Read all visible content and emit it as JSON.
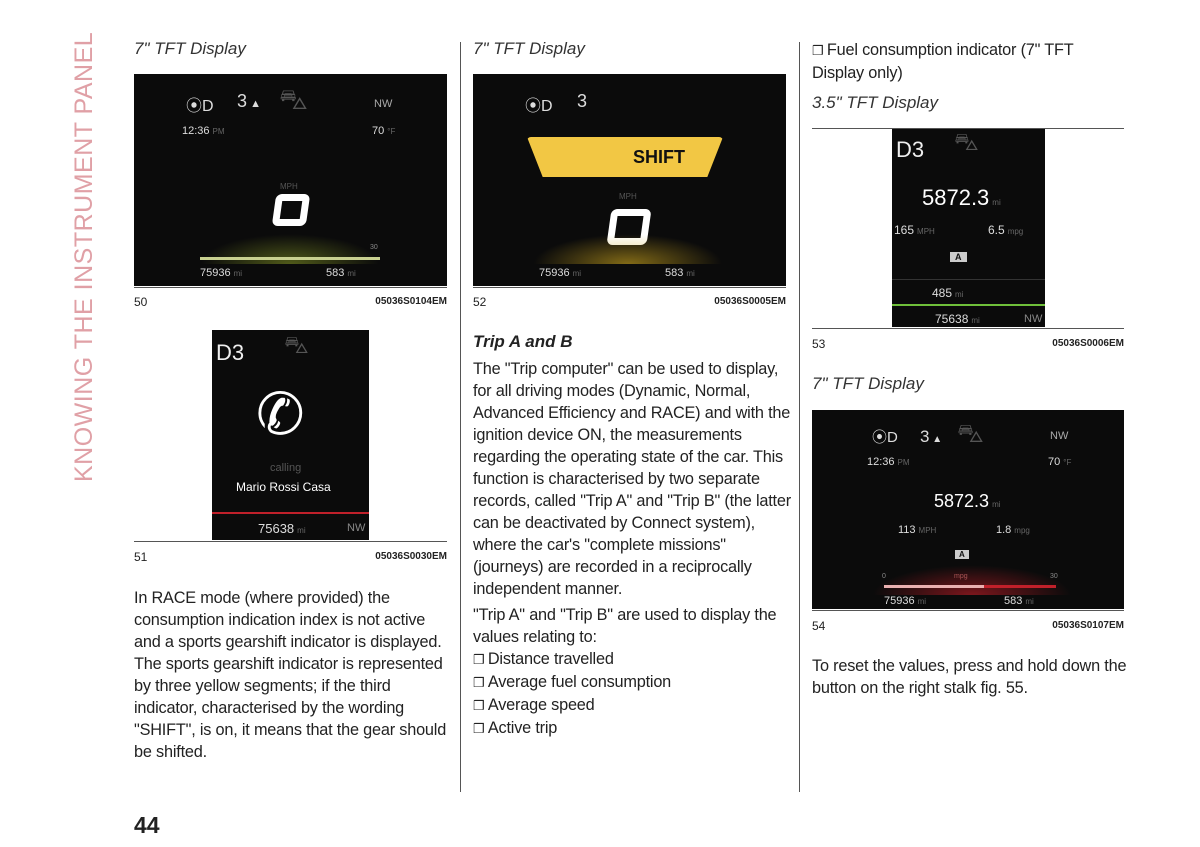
{
  "side_title": "KNOWING THE INSTRUMENT PANEL",
  "page_number": "44",
  "col1": {
    "caption": "7\" TFT Display",
    "fig50": {
      "number": "50",
      "code": "05036S0104EM",
      "gear": "3",
      "time": "12:36",
      "time_unit": "PM",
      "heading": "NW",
      "temp": "70",
      "temp_unit": "°F",
      "speed_unit": "MPH",
      "speed": "0",
      "odo": "75936",
      "odo_unit": "mi",
      "range": "583",
      "range_unit": "mi",
      "scale_max": "30"
    },
    "fig51": {
      "number": "51",
      "code": "05036S0030EM",
      "gear": "D3",
      "status": "calling",
      "contact": "Mario Rossi Casa",
      "odo": "75638",
      "odo_unit": "mi",
      "heading": "NW"
    },
    "paragraph": "In RACE mode (where provided) the consumption indication index is not active and a sports gearshift indicator is displayed. The sports gearshift indicator is represented by three yellow segments; if the third indicator, characterised by the wording \"SHIFT\", is on, it means that the gear should be shifted."
  },
  "col2": {
    "caption": "7\" TFT Display",
    "fig52": {
      "number": "52",
      "code": "05036S0005EM",
      "gear": "3",
      "shift": "SHIFT",
      "speed_unit": "MPH",
      "speed": "0",
      "odo": "75936",
      "odo_unit": "mi",
      "range": "583",
      "range_unit": "mi"
    },
    "heading": "Trip A and B",
    "paragraph1": "The \"Trip computer\" can be used to display, for all driving modes (Dynamic, Normal, Advanced Efficiency and RACE) and with the ignition device ON, the measurements regarding the operating state of the car. This function is characterised by two separate records, called \"Trip A\" and \"Trip B\" (the latter can be deactivated by Connect system), where the car's \"complete missions\" (journeys) are recorded in a reciprocally independent manner.",
    "paragraph2": "\"Trip A\" and \"Trip B\" are used to display the values relating to:",
    "bullets": [
      "Distance travelled",
      "Average fuel consumption",
      "Average speed",
      "Active trip"
    ]
  },
  "col3": {
    "bullet": "Fuel consumption indicator (7\" TFT Display only)",
    "caption1": "3.5\" TFT Display",
    "fig53": {
      "number": "53",
      "code": "05036S0006EM",
      "gear": "D3",
      "distance": "5872.3",
      "distance_unit": "mi",
      "speed": "165",
      "speed_unit": "MPH",
      "consumption": "6.5",
      "consumption_unit": "mpg",
      "trip": "A",
      "range": "485",
      "range_unit": "mi",
      "odo": "75638",
      "odo_unit": "mi",
      "heading": "NW"
    },
    "caption2": "7\" TFT Display",
    "fig54": {
      "number": "54",
      "code": "05036S0107EM",
      "gear": "3",
      "time": "12:36",
      "time_unit": "PM",
      "heading": "NW",
      "temp": "70",
      "temp_unit": "°F",
      "distance": "5872.3",
      "distance_unit": "mi",
      "speed": "113",
      "speed_unit": "MPH",
      "consumption": "1.8",
      "consumption_unit": "mpg",
      "trip": "A",
      "scale_min": "0",
      "scale_label": "mpg",
      "scale_max": "30",
      "odo": "75936",
      "odo_unit": "mi",
      "range": "583",
      "range_unit": "mi"
    },
    "paragraph": "To reset the values, press and hold down the button on the right stalk fig. 55."
  },
  "colors": {
    "accent": "#e0a0a6",
    "shift_yellow": "#f2c744",
    "light_green": "#3aa84a",
    "bar_red": "#c0202a"
  }
}
